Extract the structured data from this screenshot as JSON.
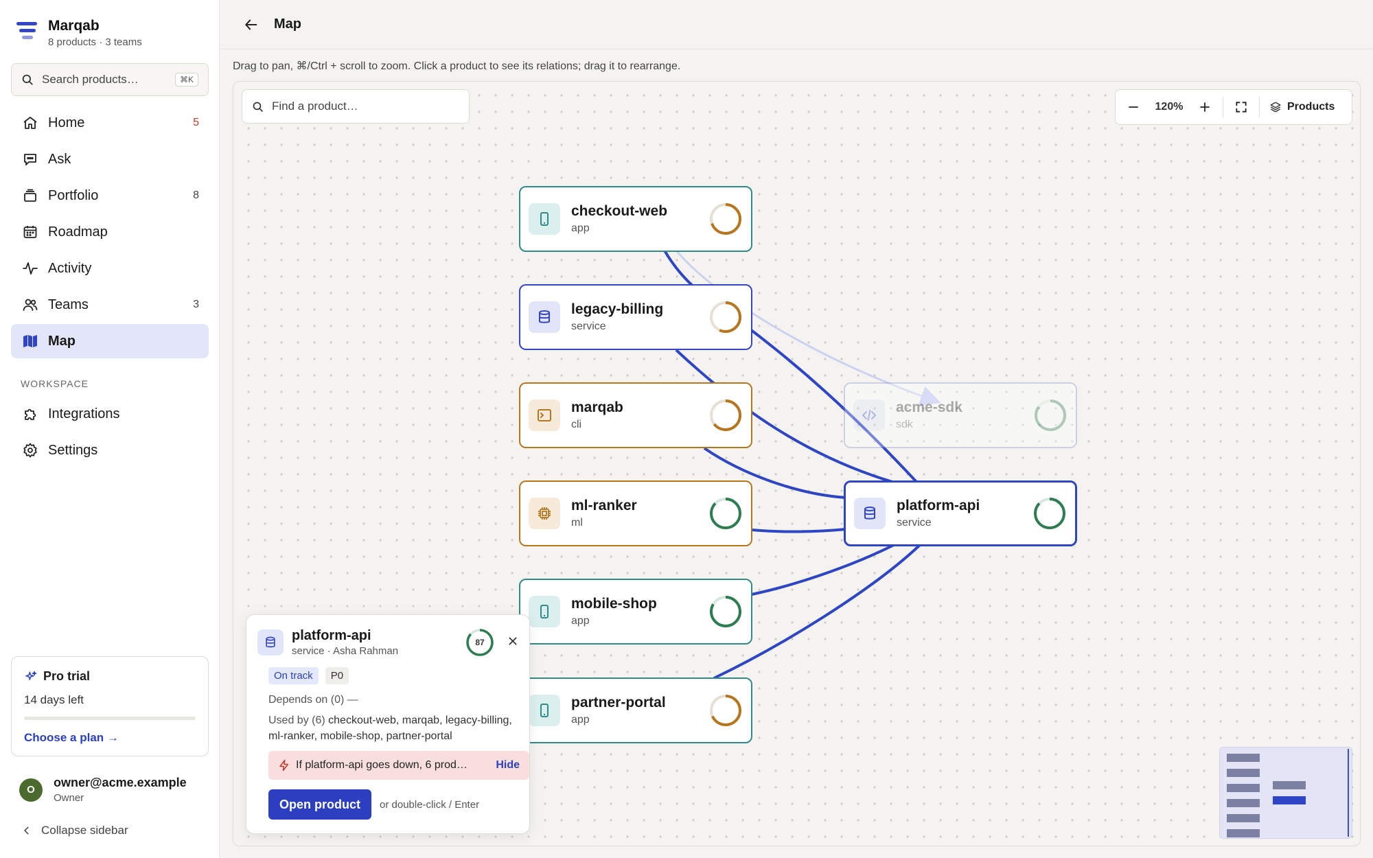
{
  "app": {
    "name": "Marqab",
    "subtitle": "8 products · 3 teams"
  },
  "sidebar": {
    "search_placeholder": "Search products…",
    "search_shortcut": "⌘K",
    "items": [
      {
        "label": "Home",
        "count": "5",
        "icon": "home-icon"
      },
      {
        "label": "Ask",
        "count": "",
        "icon": "chat-icon"
      },
      {
        "label": "Portfolio",
        "count": "8",
        "icon": "stack-icon"
      },
      {
        "label": "Roadmap",
        "count": "",
        "icon": "calendar-icon"
      },
      {
        "label": "Activity",
        "count": "",
        "icon": "activity-icon"
      },
      {
        "label": "Teams",
        "count": "3",
        "icon": "users-icon"
      },
      {
        "label": "Map",
        "count": "",
        "icon": "map-icon",
        "active": true
      }
    ],
    "workspace_label": "WORKSPACE",
    "workspace_items": [
      {
        "label": "Integrations",
        "icon": "puzzle-icon"
      },
      {
        "label": "Settings",
        "icon": "gear-icon"
      }
    ],
    "trial": {
      "title": "Pro trial",
      "days_left": "14 days left",
      "progress": 0.0,
      "cta": "Choose a plan →"
    },
    "user": {
      "initial": "O",
      "email": "owner@acme.example",
      "role": "Owner"
    },
    "collapse_label": "Collapse sidebar"
  },
  "header": {
    "title": "Map"
  },
  "hint": "Drag to pan, ⌘/Ctrl + scroll to zoom. Click a product to see its relations; drag it to rearrange.",
  "map": {
    "find_placeholder": "Find a product…",
    "zoom": "120%",
    "layers_label": "Products",
    "nodes": [
      {
        "id": "checkout-web",
        "name": "checkout-web",
        "type": "app"
      },
      {
        "id": "legacy-billing",
        "name": "legacy-billing",
        "type": "service"
      },
      {
        "id": "marqab",
        "name": "marqab",
        "type": "cli"
      },
      {
        "id": "ml-ranker",
        "name": "ml-ranker",
        "type": "ml"
      },
      {
        "id": "mobile-shop",
        "name": "mobile-shop",
        "type": "app"
      },
      {
        "id": "partner-portal",
        "name": "partner-portal",
        "type": "app"
      },
      {
        "id": "acme-sdk",
        "name": "acme-sdk",
        "type": "sdk"
      },
      {
        "id": "platform-api",
        "name": "platform-api",
        "type": "service"
      }
    ]
  },
  "details": {
    "name": "platform-api",
    "subtitle": "service · Asha Rahman",
    "score": "87",
    "status": "On track",
    "priority": "P0",
    "depends_on": "Depends on (0) —",
    "used_by_prefix": "Used by (6) ",
    "used_by": "checkout-web, marqab, legacy-billing, ml-ranker, mobile-shop, partner-portal",
    "alert": "If platform-api goes down, 6 prod…",
    "hide_label": "Hide",
    "open_label": "Open product",
    "or_label": "or double-click / Enter"
  },
  "colors": {
    "accent": "#3346c8",
    "teal": "#2f8a8a",
    "amber": "#b5761f",
    "green": "#2e7d52"
  }
}
